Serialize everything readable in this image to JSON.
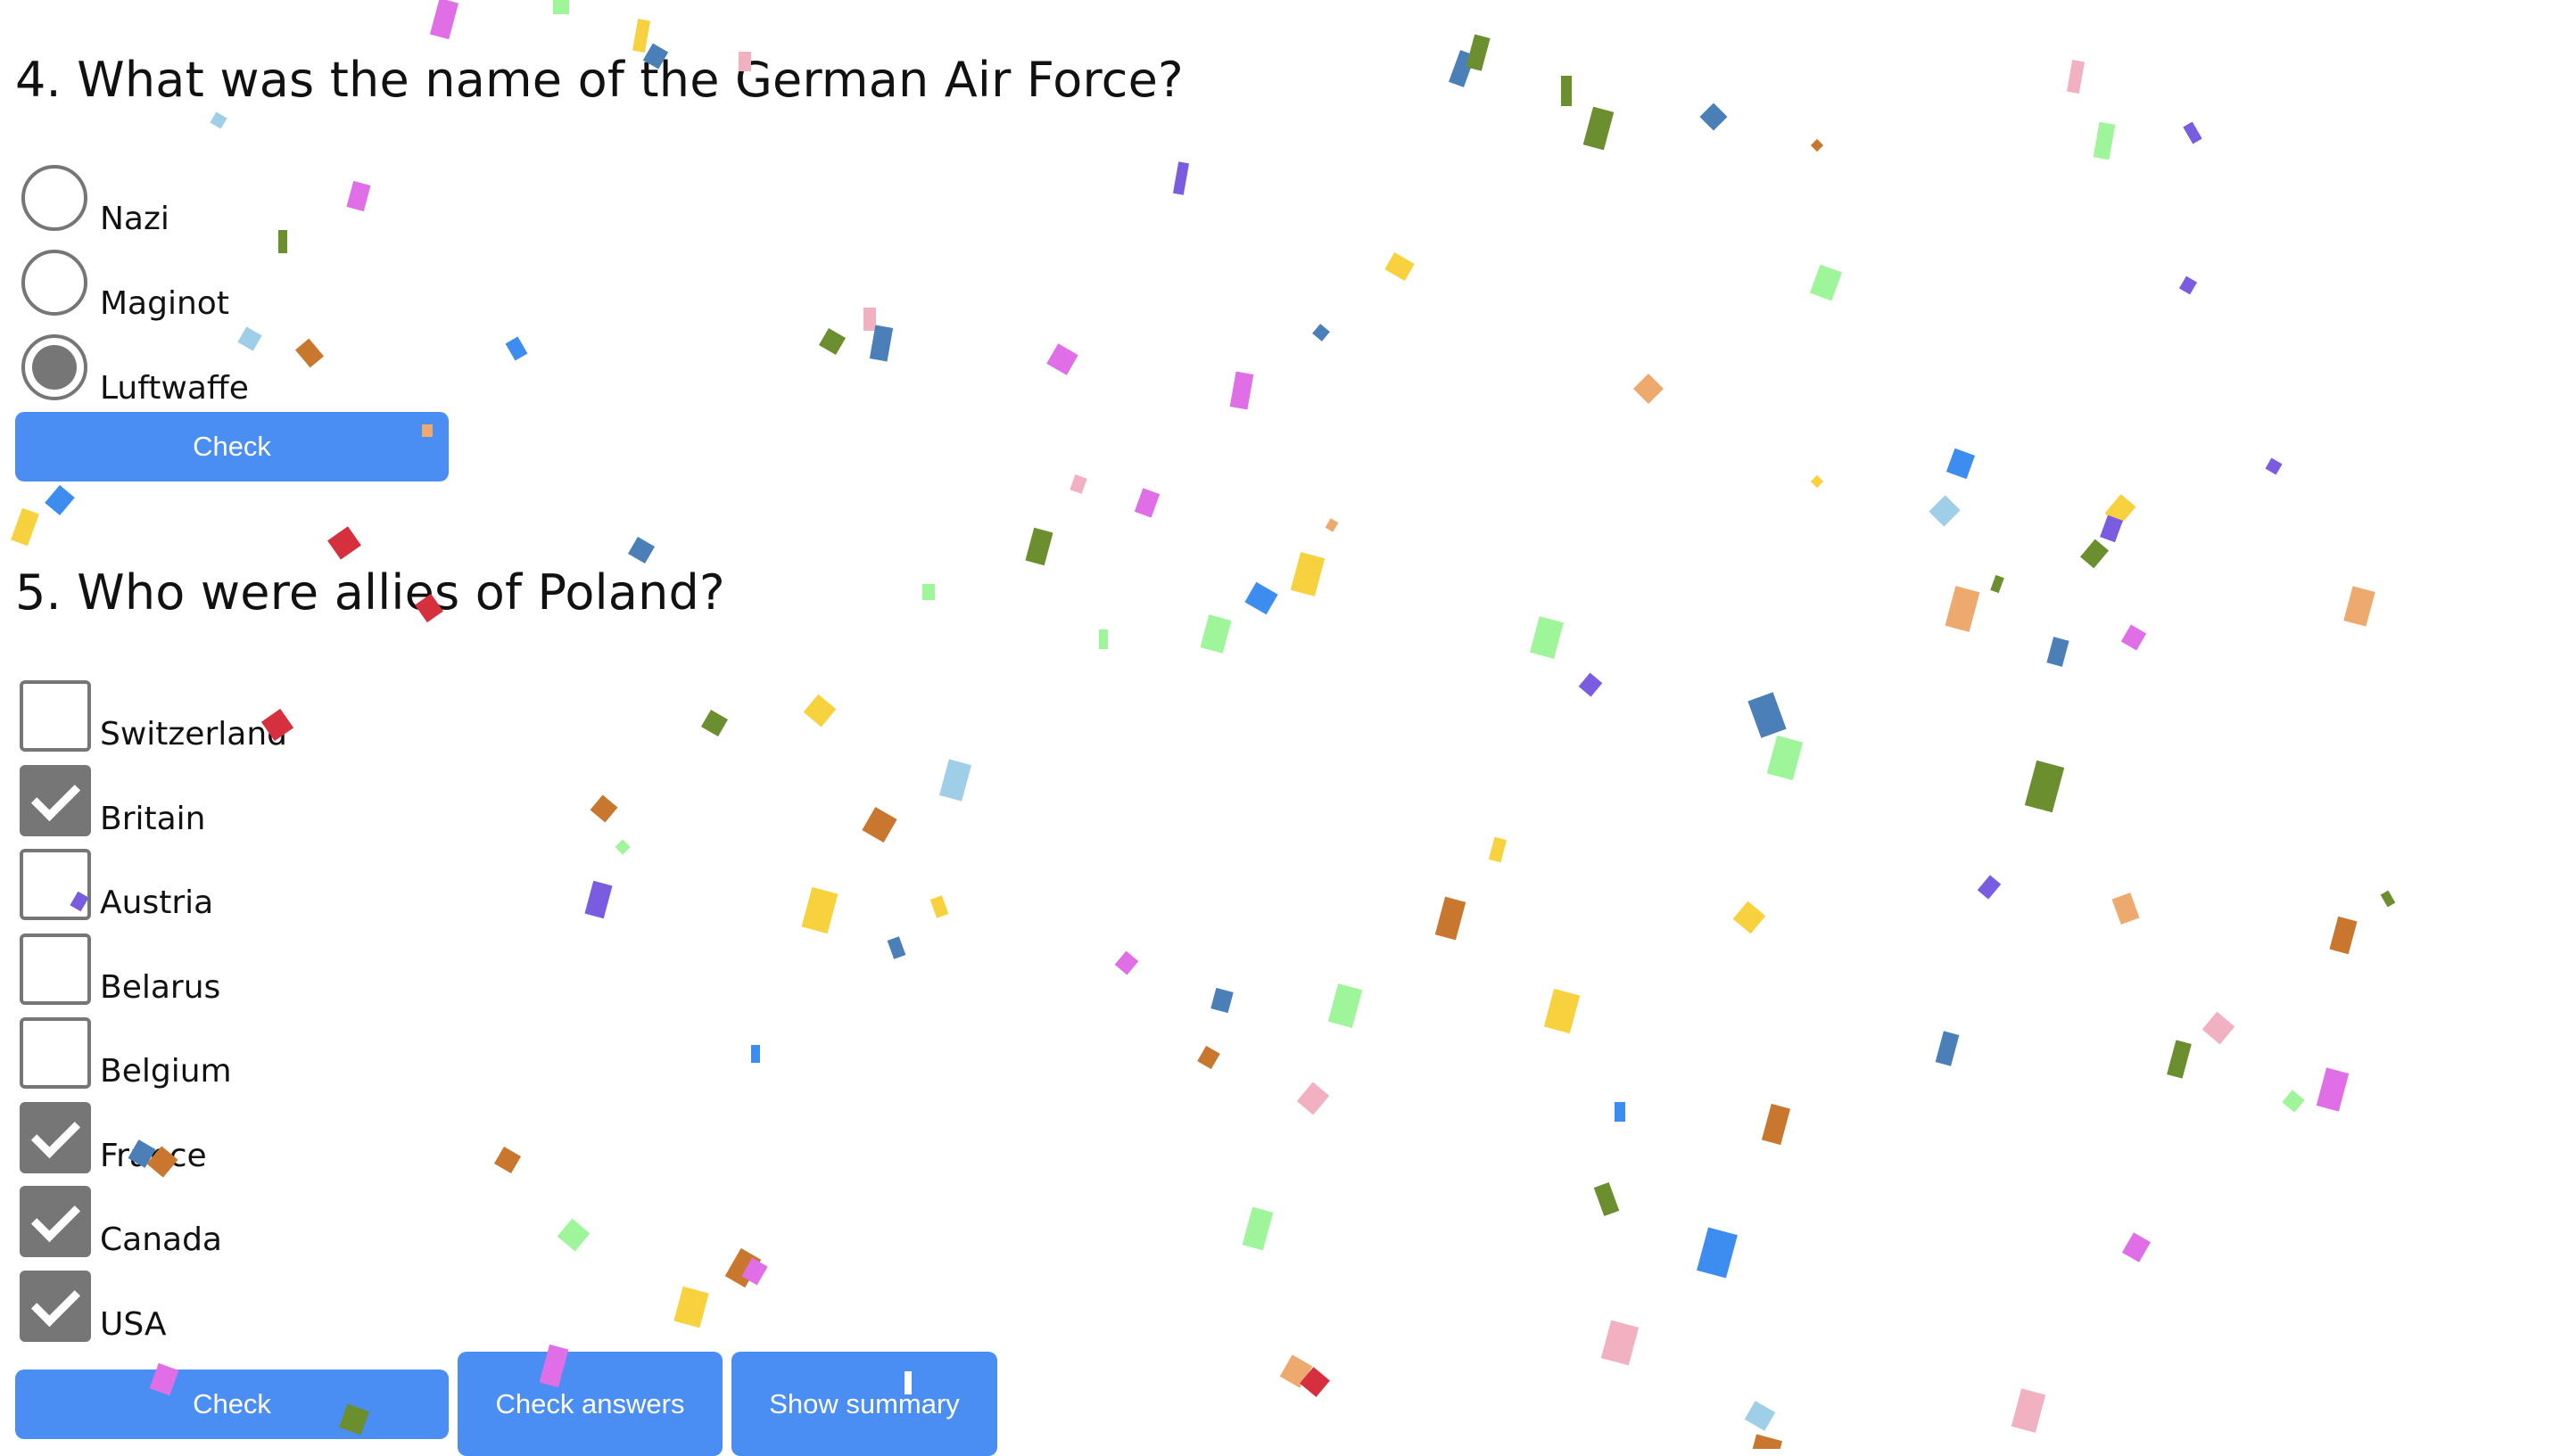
{
  "q4": {
    "title": "4. What was the name of the German Air Force?",
    "options": [
      {
        "label": "Nazi",
        "selected": false
      },
      {
        "label": "Maginot",
        "selected": false
      },
      {
        "label": "Luftwaffe",
        "selected": true
      }
    ],
    "check_label": "Check"
  },
  "q5": {
    "title": "5. Who were allies of Poland?",
    "options": [
      {
        "label": "Switzerland",
        "checked": false
      },
      {
        "label": "Britain",
        "checked": true
      },
      {
        "label": "Austria",
        "checked": false
      },
      {
        "label": "Belarus",
        "checked": false
      },
      {
        "label": "Belgium",
        "checked": false
      },
      {
        "label": "France",
        "checked": true
      },
      {
        "label": "Canada",
        "checked": true
      },
      {
        "label": "USA",
        "checked": true
      }
    ],
    "check_label": "Check"
  },
  "actions": {
    "check_answers_label": "Check answers",
    "show_summary_label": "Show summary"
  },
  "colors": {
    "button": "#4a8ef4",
    "control_gray": "#767676",
    "confetti": [
      "#6b8e2f",
      "#4a7fb8",
      "#e06ee6",
      "#f7d23e",
      "#9ef59a",
      "#c9772f",
      "#f2b1c0",
      "#7a5ce0",
      "#eeaa6e",
      "#9fcfe8",
      "#d62f3e",
      "#3d8cf0"
    ]
  }
}
